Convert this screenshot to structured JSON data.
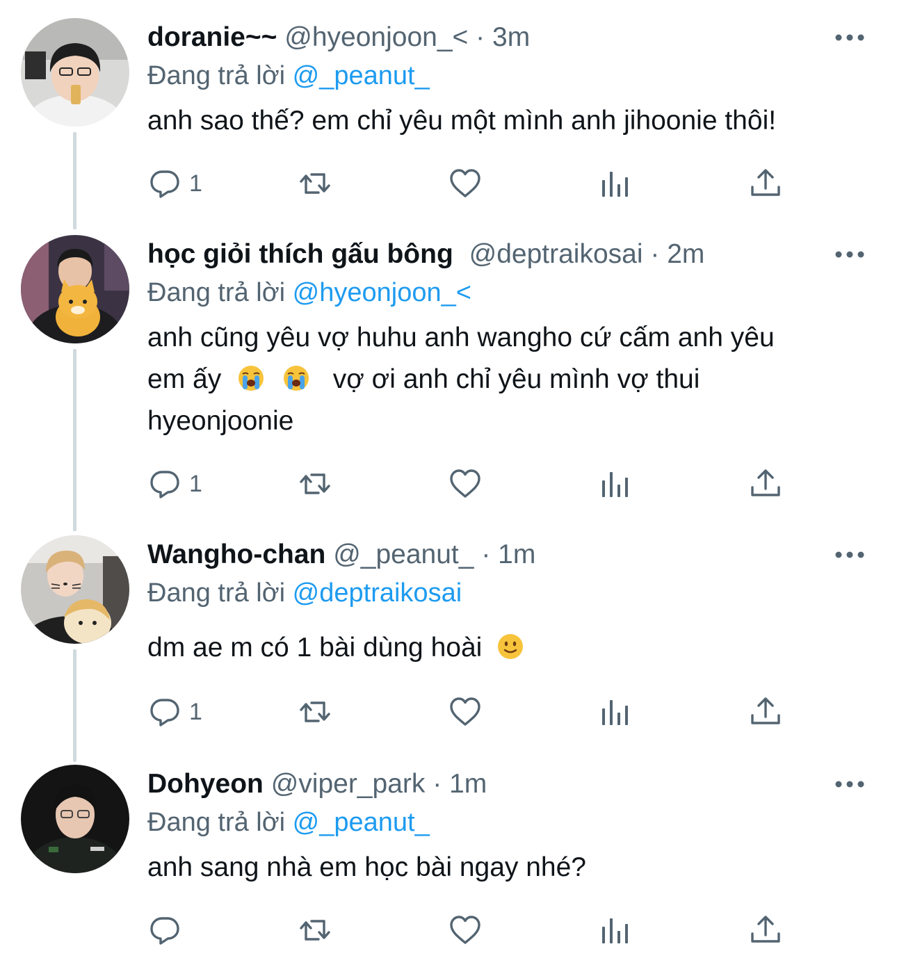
{
  "tweets": [
    {
      "display_name": "doranie~~",
      "handle": "@hyeonjoon_<",
      "time": "3m",
      "reply_prefix": "Đang trả lời",
      "reply_to": "@_peanut_",
      "text_lines": [
        "anh sao thế? em chỉ yêu một mình anh jihoonie thôi!"
      ],
      "reply_count": "1",
      "avatar": "boy-eating-snack-avatar"
    },
    {
      "display_name": "học giỏi thích gấu bông",
      "handle": "@deptraikosai",
      "time": "2m",
      "reply_prefix": "Đang trả lời",
      "reply_to": "@hyeonjoon_<",
      "text_lines": [
        "anh cũng yêu vợ huhu anh wangho cứ cấm anh yêu",
        "em ấy",
        "vợ ơi anh chỉ yêu mình vợ thui",
        "hyeonjoonie"
      ],
      "emojis": [
        "loudly-crying-face-emoji",
        "loudly-crying-face-emoji"
      ],
      "reply_count": "1",
      "avatar": "boy-with-plush-avatar"
    },
    {
      "display_name": "Wangho-chan",
      "handle": "@_peanut_",
      "time": "1m",
      "reply_prefix": "Đang trả lời",
      "reply_to": "@deptraikosai",
      "text_lines": [
        "dm ae m có 1 bài dùng hoài"
      ],
      "emojis": [
        "slightly-smiling-face-emoji"
      ],
      "reply_count": "1",
      "avatar": "boy-cat-whiskers-avatar"
    },
    {
      "display_name": "Dohyeon",
      "handle": "@viper_park",
      "time": "1m",
      "reply_prefix": "Đang trả lời",
      "reply_to": "@_peanut_",
      "text_lines": [
        "anh sang nhà em học bài ngay nhé?"
      ],
      "reply_count": "",
      "avatar": "boy-in-jersey-avatar"
    }
  ],
  "separator": "·",
  "colors": {
    "text": "#0f1419",
    "secondary": "#536471",
    "link": "#1d9bf0",
    "thread_line": "#cfd9de"
  },
  "icons": {
    "reply": "reply-icon",
    "retweet": "retweet-icon",
    "like": "like-icon",
    "views": "views-icon",
    "share": "share-icon",
    "more": "more-icon"
  }
}
